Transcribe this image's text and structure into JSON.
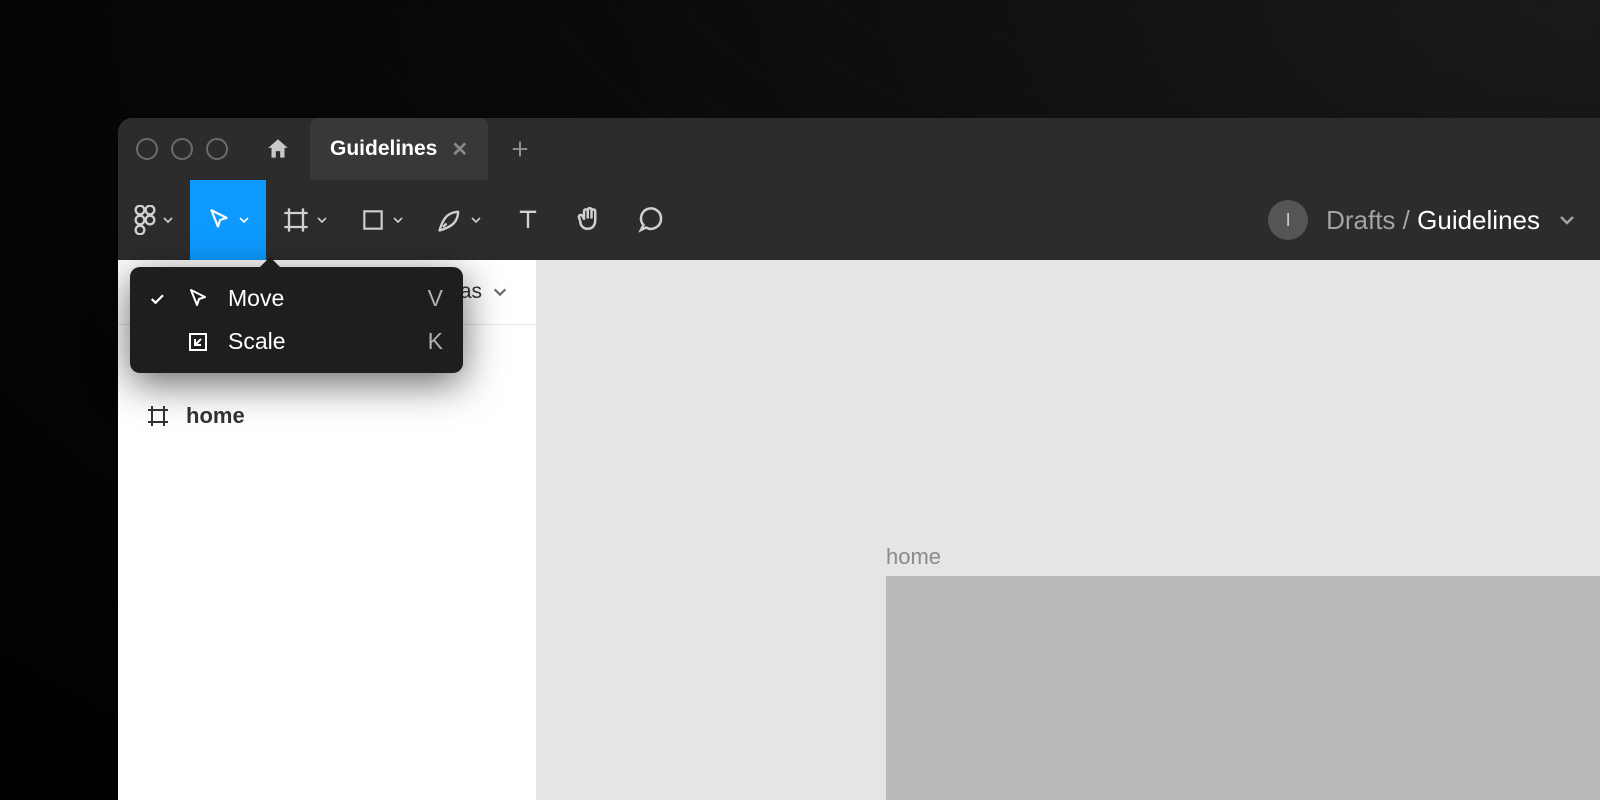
{
  "tabs": {
    "active_label": "Guidelines"
  },
  "breadcrumb": {
    "parent": "Drafts",
    "separator": "/",
    "current": "Guidelines"
  },
  "avatar": {
    "initial": "I"
  },
  "left_panel": {
    "header_partial": "vas",
    "layers": [
      {
        "name": "home"
      }
    ]
  },
  "canvas": {
    "frame_label": "home"
  },
  "dropdown": {
    "items": [
      {
        "checked": true,
        "icon": "move-icon",
        "label": "Move",
        "shortcut": "V"
      },
      {
        "checked": false,
        "icon": "scale-icon",
        "label": "Scale",
        "shortcut": "K"
      }
    ]
  }
}
